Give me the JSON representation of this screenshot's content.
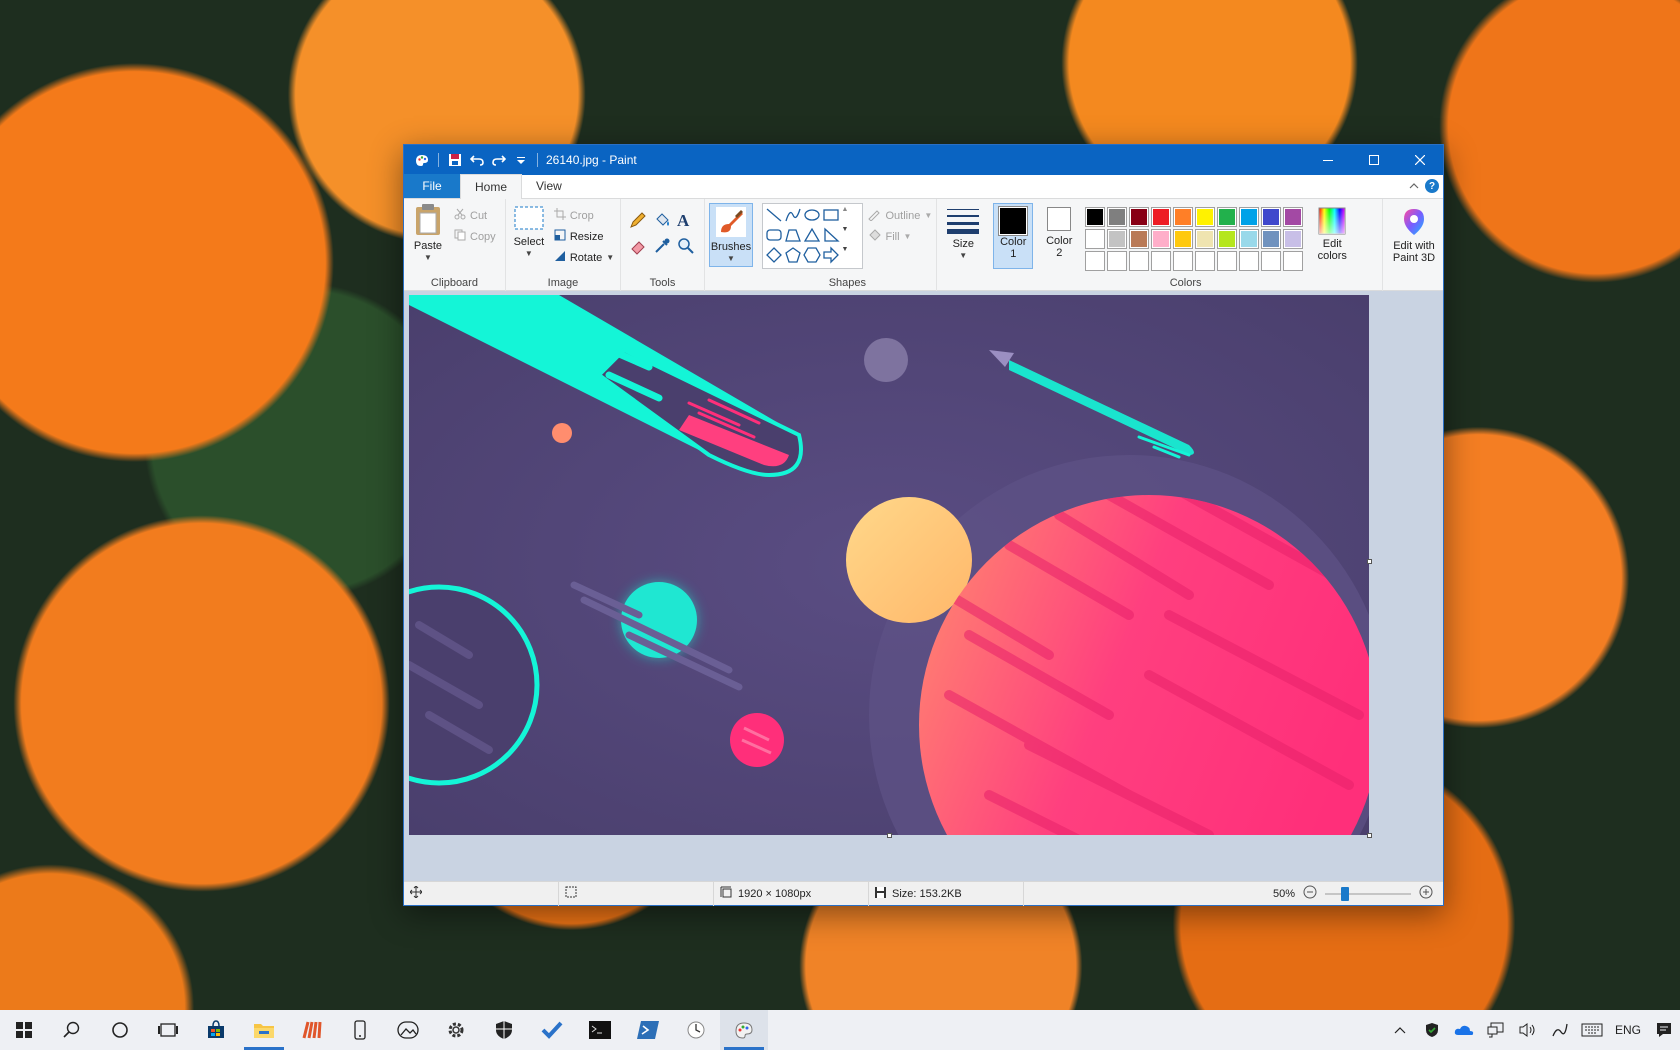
{
  "window": {
    "title": "26140.jpg - Paint"
  },
  "tabs": {
    "file": "File",
    "home": "Home",
    "view": "View"
  },
  "ribbon": {
    "clipboard": {
      "label": "Clipboard",
      "paste": "Paste",
      "cut": "Cut",
      "copy": "Copy"
    },
    "image": {
      "label": "Image",
      "select": "Select",
      "crop": "Crop",
      "resize": "Resize",
      "rotate": "Rotate"
    },
    "tools": {
      "label": "Tools"
    },
    "brushes": {
      "label": "Brushes"
    },
    "shapes": {
      "label": "Shapes",
      "outline": "Outline",
      "fill": "Fill"
    },
    "size": {
      "label": "Size"
    },
    "colors": {
      "label": "Colors",
      "color1": "Color 1",
      "color2": "Color 2",
      "edit_colors": "Edit colors",
      "edit_paint3d": "Edit with Paint 3D",
      "row1": [
        "#000000",
        "#7f7f7f",
        "#880015",
        "#ed1c24",
        "#ff7f27",
        "#fff200",
        "#22b14c",
        "#00a2e8",
        "#3f48cc",
        "#a349a4"
      ],
      "row2": [
        "#ffffff",
        "#c3c3c3",
        "#b97a57",
        "#ffaec9",
        "#ffc90e",
        "#efe4b0",
        "#b5e61d",
        "#99d9ea",
        "#7092be",
        "#c8bfe7"
      ],
      "row3": [
        "#ffffff",
        "#ffffff",
        "#ffffff",
        "#ffffff",
        "#ffffff",
        "#ffffff",
        "#ffffff",
        "#ffffff",
        "#ffffff",
        "#ffffff"
      ]
    }
  },
  "status": {
    "dimensions": "1920 × 1080px",
    "size": "Size: 153.2KB",
    "zoom": "50%",
    "zoom_slider_fraction": 0.23
  },
  "taskbar": {
    "language": "ENG"
  }
}
